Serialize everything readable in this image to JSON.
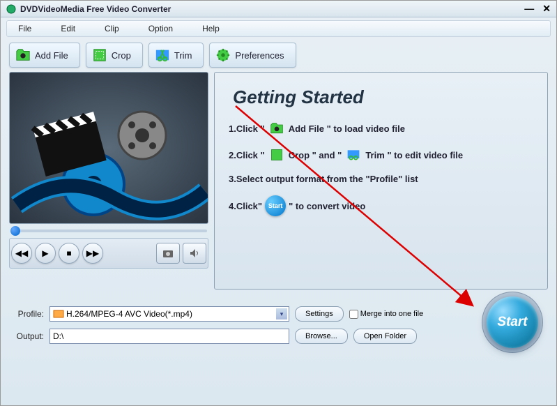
{
  "window": {
    "title": "DVDVideoMedia Free Video Converter"
  },
  "menu": {
    "file": "File",
    "edit": "Edit",
    "clip": "Clip",
    "option": "Option",
    "help": "Help"
  },
  "toolbar": {
    "add_file": "Add File",
    "crop": "Crop",
    "trim": "Trim",
    "preferences": "Preferences"
  },
  "guide": {
    "title": "Getting Started",
    "step1_a": "1.Click \"",
    "step1_b": "Add File \" to load video file",
    "step2_a": "2.Click \"",
    "step2_b": "Crop \" and \"",
    "step2_c": "Trim \" to edit video file",
    "step3": "3.Select output format from the \"Profile\" list",
    "step4_a": "4.Click\"",
    "step4_b": "\" to convert video",
    "start_small": "Start"
  },
  "form": {
    "profile_label": "Profile:",
    "profile_value": "H.264/MPEG-4 AVC Video(*.mp4)",
    "output_label": "Output:",
    "output_value": "D:\\",
    "settings": "Settings",
    "browse": "Browse...",
    "merge": "Merge into one file",
    "open_folder": "Open Folder"
  },
  "start_button": "Start"
}
